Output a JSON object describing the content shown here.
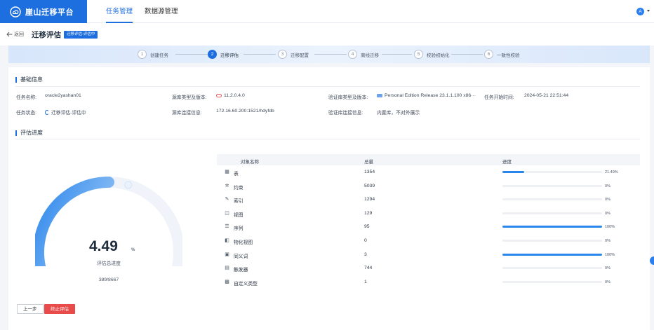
{
  "app": {
    "title": "崖山迁移平台",
    "nav": [
      "任务管理",
      "数据源管理"
    ],
    "user_initial": "A"
  },
  "header": {
    "back_label": "返回",
    "title": "迁移评估",
    "badge": "迁移评估-评估中"
  },
  "steps": [
    {
      "num": "1",
      "label": "创建任务"
    },
    {
      "num": "2",
      "label": "迁移评估"
    },
    {
      "num": "3",
      "label": "迁移配置"
    },
    {
      "num": "4",
      "label": "离线迁移"
    },
    {
      "num": "5",
      "label": "校验初始化"
    },
    {
      "num": "6",
      "label": "一致性校验"
    }
  ],
  "basic_info": {
    "title": "基础信息",
    "task_name_label": "任务名称:",
    "task_name": "oracle2yashan01",
    "source_type_label": "源库类型及版本:",
    "source_type": "11.2.0.4.0",
    "verify_type_label": "验证库类型及版本:",
    "verify_type": "Personal Edition Release 23.1.1.100 x86···",
    "start_time_label": "任务开始时间:",
    "start_time": "2024-05-21 22:51:44",
    "status_label": "任务状态:",
    "status": "迁移评估-评估中",
    "source_conn_label": "源库连接信息:",
    "source_conn": "172.16.60.200:1521/hdyfdb",
    "verify_conn_label": "验证库连接信息:",
    "verify_conn": "内置库，不对外展示"
  },
  "progress": {
    "title": "评估进度",
    "value": "4.49",
    "unit": "%",
    "percent": 4.49,
    "label": "评估总进度",
    "count": "389/8667"
  },
  "table": {
    "headers": [
      "对象名称",
      "总量",
      "进度"
    ],
    "rows": [
      {
        "icon": "▦",
        "name": "表",
        "total": "1354",
        "pct": "21.49%",
        "fill": 21.49
      },
      {
        "icon": "✲",
        "name": "约束",
        "total": "5039",
        "pct": "0%",
        "fill": 0
      },
      {
        "icon": "✎",
        "name": "索引",
        "total": "1294",
        "pct": "0%",
        "fill": 0
      },
      {
        "icon": "◫",
        "name": "视图",
        "total": "129",
        "pct": "0%",
        "fill": 0
      },
      {
        "icon": "☰",
        "name": "序列",
        "total": "95",
        "pct": "100%",
        "fill": 100
      },
      {
        "icon": "◧",
        "name": "物化视图",
        "total": "0",
        "pct": "0%",
        "fill": 0
      },
      {
        "icon": "▣",
        "name": "同义词",
        "total": "3",
        "pct": "100%",
        "fill": 100
      },
      {
        "icon": "▤",
        "name": "触发器",
        "total": "744",
        "pct": "0%",
        "fill": 0
      },
      {
        "icon": "▩",
        "name": "自定义类型",
        "total": "1",
        "pct": "0%",
        "fill": 0
      }
    ]
  },
  "footer": {
    "prev_label": "上一步",
    "stop_label": "终止评估"
  },
  "colors": {
    "brand": "#1d6fe0",
    "danger": "#e94a4a",
    "progress": "#2b86ec"
  }
}
